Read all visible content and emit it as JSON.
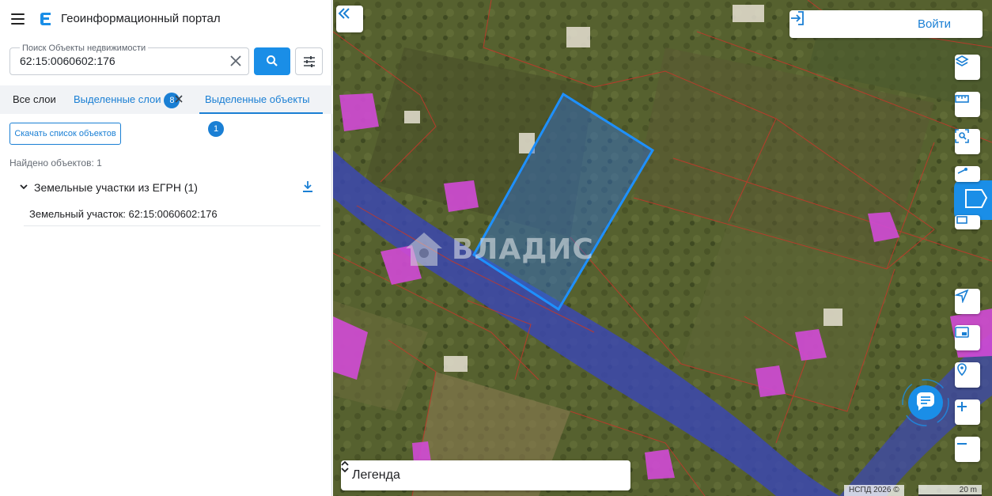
{
  "header": {
    "title": "Геоинформационный портал"
  },
  "search": {
    "label": "Поиск Объекты недвижимости",
    "value": "62:15:0060602:176"
  },
  "tabs": {
    "all_layers": "Все слои",
    "selected_layers": "Выделенные слои",
    "selected_layers_count": "8",
    "selected_objects": "Выделенные объекты",
    "selected_objects_count": "1"
  },
  "results": {
    "download_label": "Скачать список объектов",
    "found_text": "Найдено объектов: 1",
    "group_title": "Земельные участки из ЕГРН (1)",
    "items": [
      {
        "label": "Земельный участок: 62:15:0060602:176"
      }
    ]
  },
  "map": {
    "login_label": "Войти",
    "legend_label": "Легенда",
    "attribution": "НСПД 2026 ©",
    "scale_label": "20 m",
    "watermark": "ВЛАДИС"
  },
  "colors": {
    "accent": "#1a8ee7",
    "parcel_outline": "#1e90ff",
    "boundary_lines": "#c0392b",
    "building": "#d14ad6",
    "road": "#3a46b8"
  }
}
